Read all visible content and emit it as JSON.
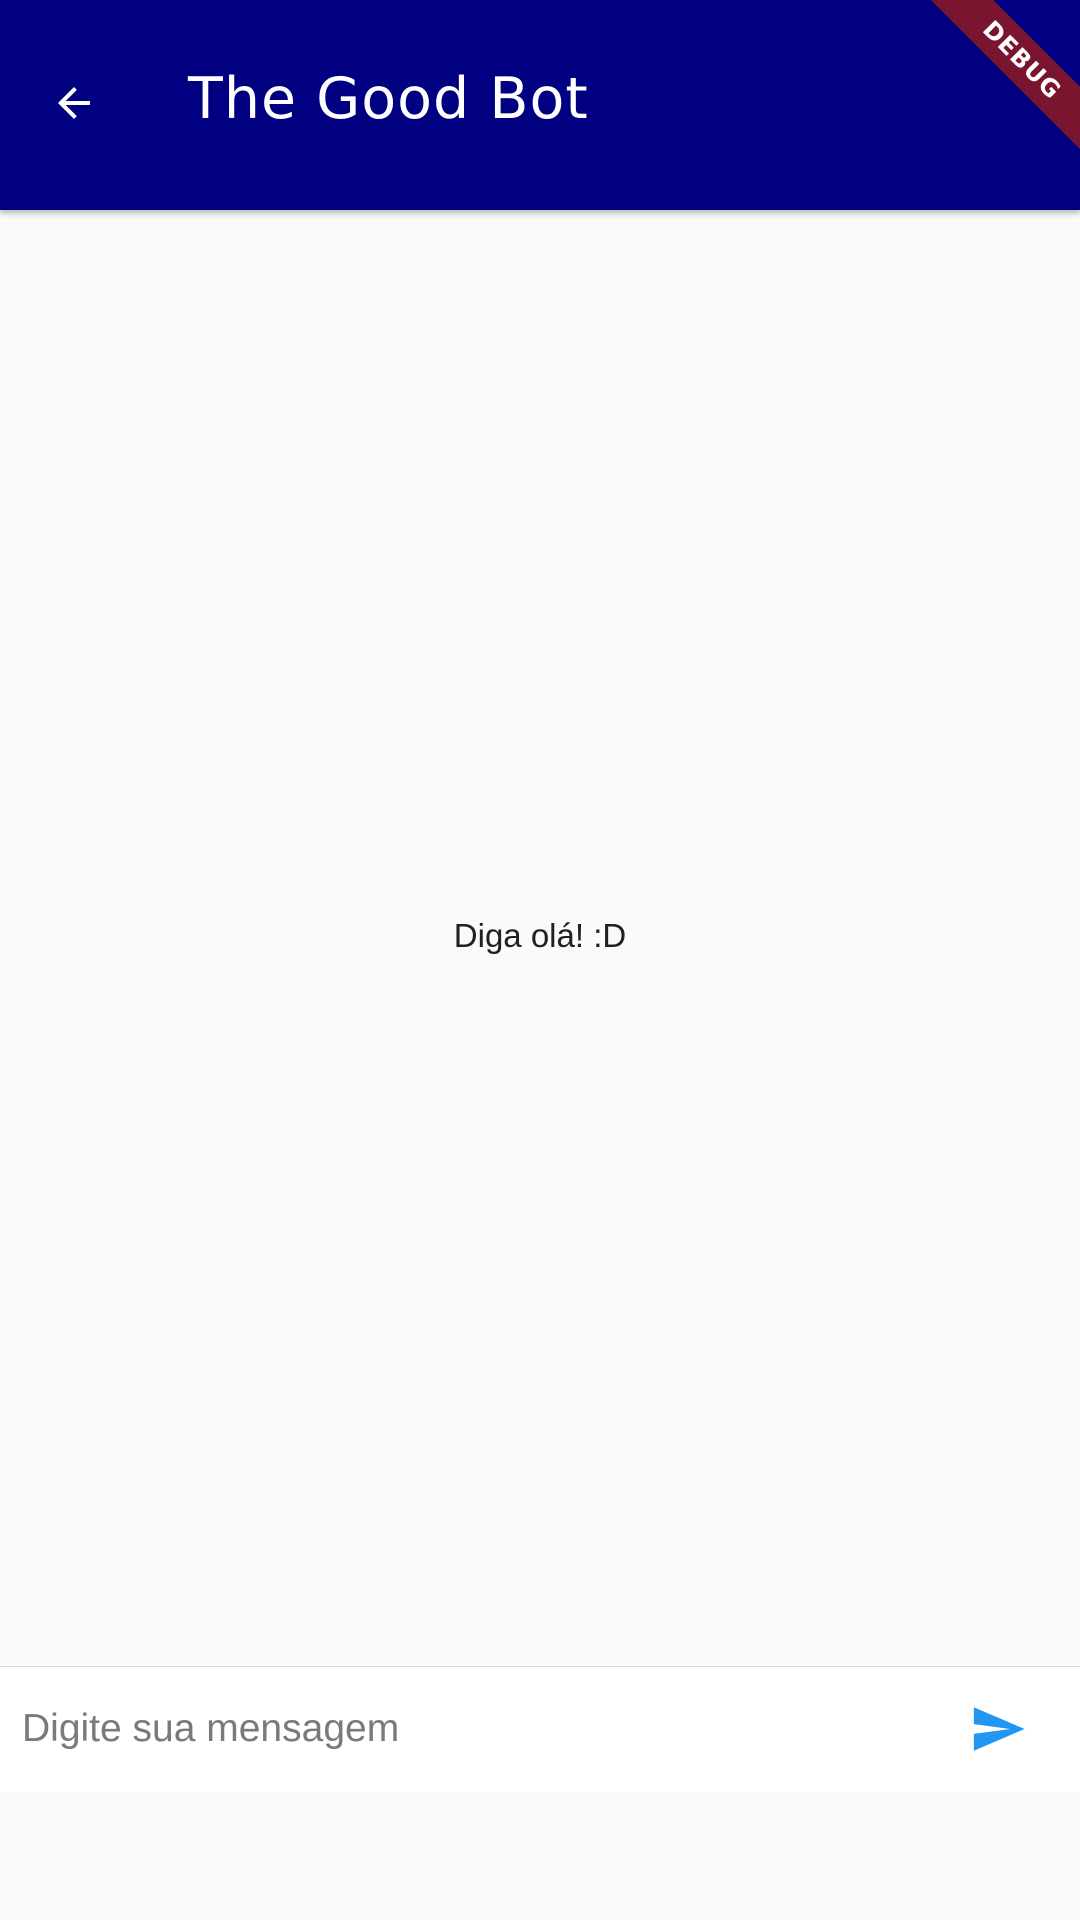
{
  "appbar": {
    "title": "The Good Bot",
    "background_color": "#000080",
    "back_icon": "arrow-left-icon"
  },
  "debug_banner": {
    "label": "DEBUG",
    "color": "#7a1530"
  },
  "chat": {
    "empty_state_text": "Diga olá! :D"
  },
  "composer": {
    "placeholder": "Digite sua mensagem",
    "value": "",
    "send_icon": "send-icon",
    "send_color": "#2196f3"
  }
}
